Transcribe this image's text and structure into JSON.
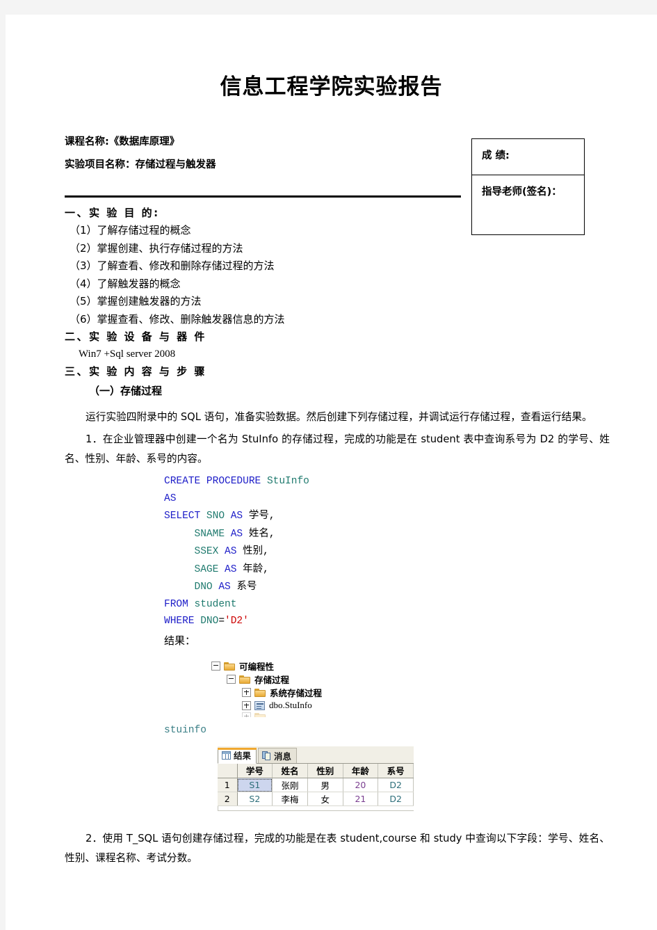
{
  "document": {
    "title": "信息工程学院实验报告",
    "course_label": "课程名称:《数据库原理》",
    "project_label": "实验项目名称：存储过程与触发器"
  },
  "grade_box": {
    "score_label": "成  绩:",
    "teacher_label": "指导老师(签名)："
  },
  "section1": {
    "heading": "一、实 验 目 的:",
    "items": [
      "（1）了解存储过程的概念",
      "（2）掌握创建、执行存储过程的方法",
      "（3）了解查看、修改和删除存储过程的方法",
      "（4）了解触发器的概念",
      "（5）掌握创建触发器的方法",
      "（6）掌握查看、修改、删除触发器信息的方法"
    ]
  },
  "section2": {
    "heading": "二、实 验 设 备 与 器 件",
    "equipment": "Win7 +Sql server 2008"
  },
  "section3": {
    "heading": "三、实 验 内 容 与 步 骤",
    "subheading": "（一）存储过程",
    "intro": "运行实验四附录中的 SQL 语句，准备实验数据。然后创建下列存储过程，并调试运行存储过程，查看运行结果。",
    "task1": "1．在企业管理器中创建一个名为 StuInfo 的存储过程，完成的功能是在 student 表中查询系号为 D2 的学号、姓名、性别、年龄、系号的内容。",
    "task2": "2．使用 T_SQL 语句创建存储过程，完成的功能是在表 student,course 和 study 中查询以下字段：学号、姓名、性别、课程名称、考试分数。"
  },
  "sql_code": {
    "lines": [
      {
        "indent": 0,
        "tokens": [
          {
            "t": "CREATE",
            "c": "kw"
          },
          {
            "t": " ",
            "c": "plain"
          },
          {
            "t": "PROCEDURE",
            "c": "kw"
          },
          {
            "t": " ",
            "c": "plain"
          },
          {
            "t": "StuInfo",
            "c": "id"
          }
        ]
      },
      {
        "indent": 0,
        "tokens": [
          {
            "t": "AS",
            "c": "kw"
          }
        ]
      },
      {
        "indent": 0,
        "tokens": [
          {
            "t": "SELECT",
            "c": "kw"
          },
          {
            "t": " ",
            "c": "plain"
          },
          {
            "t": "SNO",
            "c": "id"
          },
          {
            "t": " ",
            "c": "plain"
          },
          {
            "t": "AS",
            "c": "kw"
          },
          {
            "t": " ",
            "c": "plain"
          },
          {
            "t": "学号",
            "c": "cn"
          },
          {
            "t": ",",
            "c": "plain"
          }
        ]
      },
      {
        "indent": 5,
        "tokens": [
          {
            "t": "SNAME",
            "c": "id"
          },
          {
            "t": " ",
            "c": "plain"
          },
          {
            "t": "AS",
            "c": "kw"
          },
          {
            "t": " ",
            "c": "plain"
          },
          {
            "t": "姓名",
            "c": "cn"
          },
          {
            "t": ",",
            "c": "plain"
          }
        ]
      },
      {
        "indent": 5,
        "tokens": [
          {
            "t": "SSEX",
            "c": "id"
          },
          {
            "t": " ",
            "c": "plain"
          },
          {
            "t": "AS",
            "c": "kw"
          },
          {
            "t": " ",
            "c": "plain"
          },
          {
            "t": "性别",
            "c": "cn"
          },
          {
            "t": ",",
            "c": "plain"
          }
        ]
      },
      {
        "indent": 5,
        "tokens": [
          {
            "t": "SAGE",
            "c": "id"
          },
          {
            "t": " ",
            "c": "plain"
          },
          {
            "t": "AS",
            "c": "kw"
          },
          {
            "t": " ",
            "c": "plain"
          },
          {
            "t": "年龄",
            "c": "cn"
          },
          {
            "t": ",",
            "c": "plain"
          }
        ]
      },
      {
        "indent": 5,
        "tokens": [
          {
            "t": "DNO",
            "c": "id"
          },
          {
            "t": " ",
            "c": "plain"
          },
          {
            "t": "AS",
            "c": "kw"
          },
          {
            "t": " ",
            "c": "plain"
          },
          {
            "t": "系号",
            "c": "cn"
          }
        ]
      },
      {
        "indent": 0,
        "tokens": [
          {
            "t": "FROM",
            "c": "kw"
          },
          {
            "t": " ",
            "c": "plain"
          },
          {
            "t": "student",
            "c": "id"
          }
        ]
      },
      {
        "indent": 0,
        "tokens": [
          {
            "t": "WHERE",
            "c": "kw"
          },
          {
            "t": " ",
            "c": "plain"
          },
          {
            "t": "DNO",
            "c": "id"
          },
          {
            "t": "=",
            "c": "plain"
          },
          {
            "t": "'D2'",
            "c": "str"
          }
        ]
      }
    ],
    "result_label": "结果："
  },
  "object_explorer": {
    "nodes": [
      {
        "level": 1,
        "expander": "minus",
        "icon": "folder-icon",
        "label": "可编程性",
        "bold": true
      },
      {
        "level": 2,
        "expander": "minus",
        "icon": "folder-icon",
        "label": "存储过程",
        "bold": true
      },
      {
        "level": 3,
        "expander": "plus",
        "icon": "folder-icon",
        "label": "系统存储过程",
        "bold": true
      },
      {
        "level": 3,
        "expander": "plus",
        "icon": "stored-procedure-icon",
        "label": "dbo.StuInfo",
        "bold": false
      }
    ]
  },
  "stuinfo_exec": "stuinfo",
  "results_pane": {
    "tabs": [
      {
        "label": "结果",
        "icon": "grid-icon",
        "active": true
      },
      {
        "label": "消息",
        "icon": "message-icon",
        "active": false
      }
    ],
    "columns": [
      "学号",
      "姓名",
      "性别",
      "年龄",
      "系号"
    ],
    "rows": [
      {
        "num": "1",
        "cells": [
          "S1",
          "张刚",
          "男",
          "20",
          "D2"
        ]
      },
      {
        "num": "2",
        "cells": [
          "S2",
          "李梅",
          "女",
          "21",
          "D2"
        ]
      }
    ],
    "selected_cell": {
      "row": 0,
      "col": 0
    }
  },
  "colors": {
    "keyword": "#1c1cc8",
    "identifier": "#1f7a6e",
    "string": "#cc0000",
    "tab_accent": "#f0a830",
    "selection": "#cdd6ee"
  }
}
